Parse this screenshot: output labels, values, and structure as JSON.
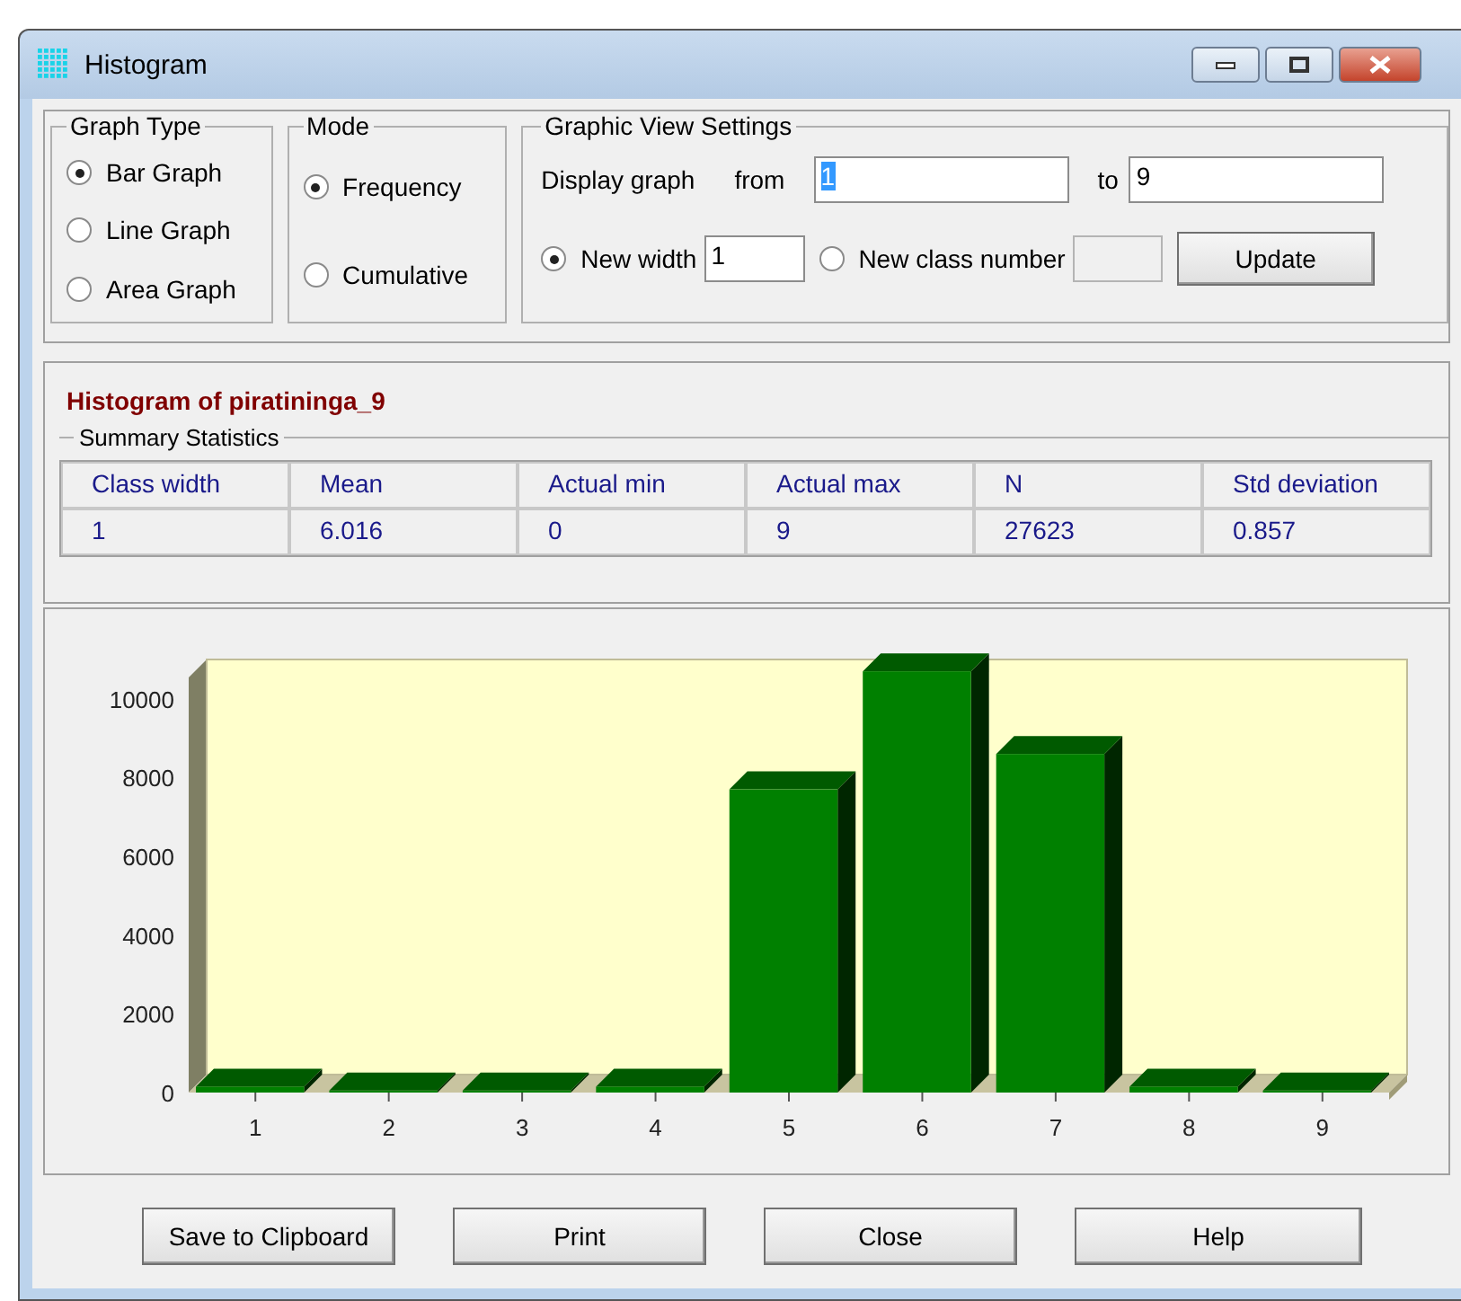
{
  "window": {
    "title": "Histogram"
  },
  "graph_type": {
    "label": "Graph Type",
    "options": [
      {
        "label": "Bar Graph",
        "selected": true
      },
      {
        "label": "Line Graph",
        "selected": false
      },
      {
        "label": "Area Graph",
        "selected": false
      }
    ]
  },
  "mode": {
    "label": "Mode",
    "options": [
      {
        "label": "Frequency",
        "selected": true
      },
      {
        "label": "Cumulative",
        "selected": false
      }
    ]
  },
  "view_settings": {
    "label": "Graphic View Settings",
    "display_label": "Display graph",
    "from_label": "from",
    "from_value": "1",
    "from_text_selected": true,
    "to_label": "to",
    "to_value": "9",
    "width_option": {
      "label": "New width",
      "selected": true,
      "value": "1"
    },
    "class_option": {
      "label": "New class number",
      "selected": false,
      "field_disabled": true
    },
    "update_button": "Update"
  },
  "result": {
    "title": "Histogram of piratininga_9",
    "summary_label": "Summary Statistics",
    "columns": [
      "Class width",
      "Mean",
      "Actual min",
      "Actual max",
      "N",
      "Std deviation"
    ],
    "rows": [
      [
        "1",
        "6.016",
        "0",
        "9",
        "27623",
        "0.857"
      ]
    ]
  },
  "chart_data": {
    "type": "bar",
    "categories": [
      "1",
      "2",
      "3",
      "4",
      "5",
      "6",
      "7",
      "8",
      "9"
    ],
    "series": [
      {
        "color": "#008000",
        "values": [
          150,
          50,
          50,
          150,
          7700,
          10700,
          8600,
          150,
          50
        ]
      }
    ],
    "ylim": [
      0,
      11000
    ],
    "yticks": [
      0,
      2000,
      4000,
      6000,
      8000,
      10000
    ]
  },
  "buttons": [
    "Save to Clipboard",
    "Print",
    "Close",
    "Help"
  ]
}
